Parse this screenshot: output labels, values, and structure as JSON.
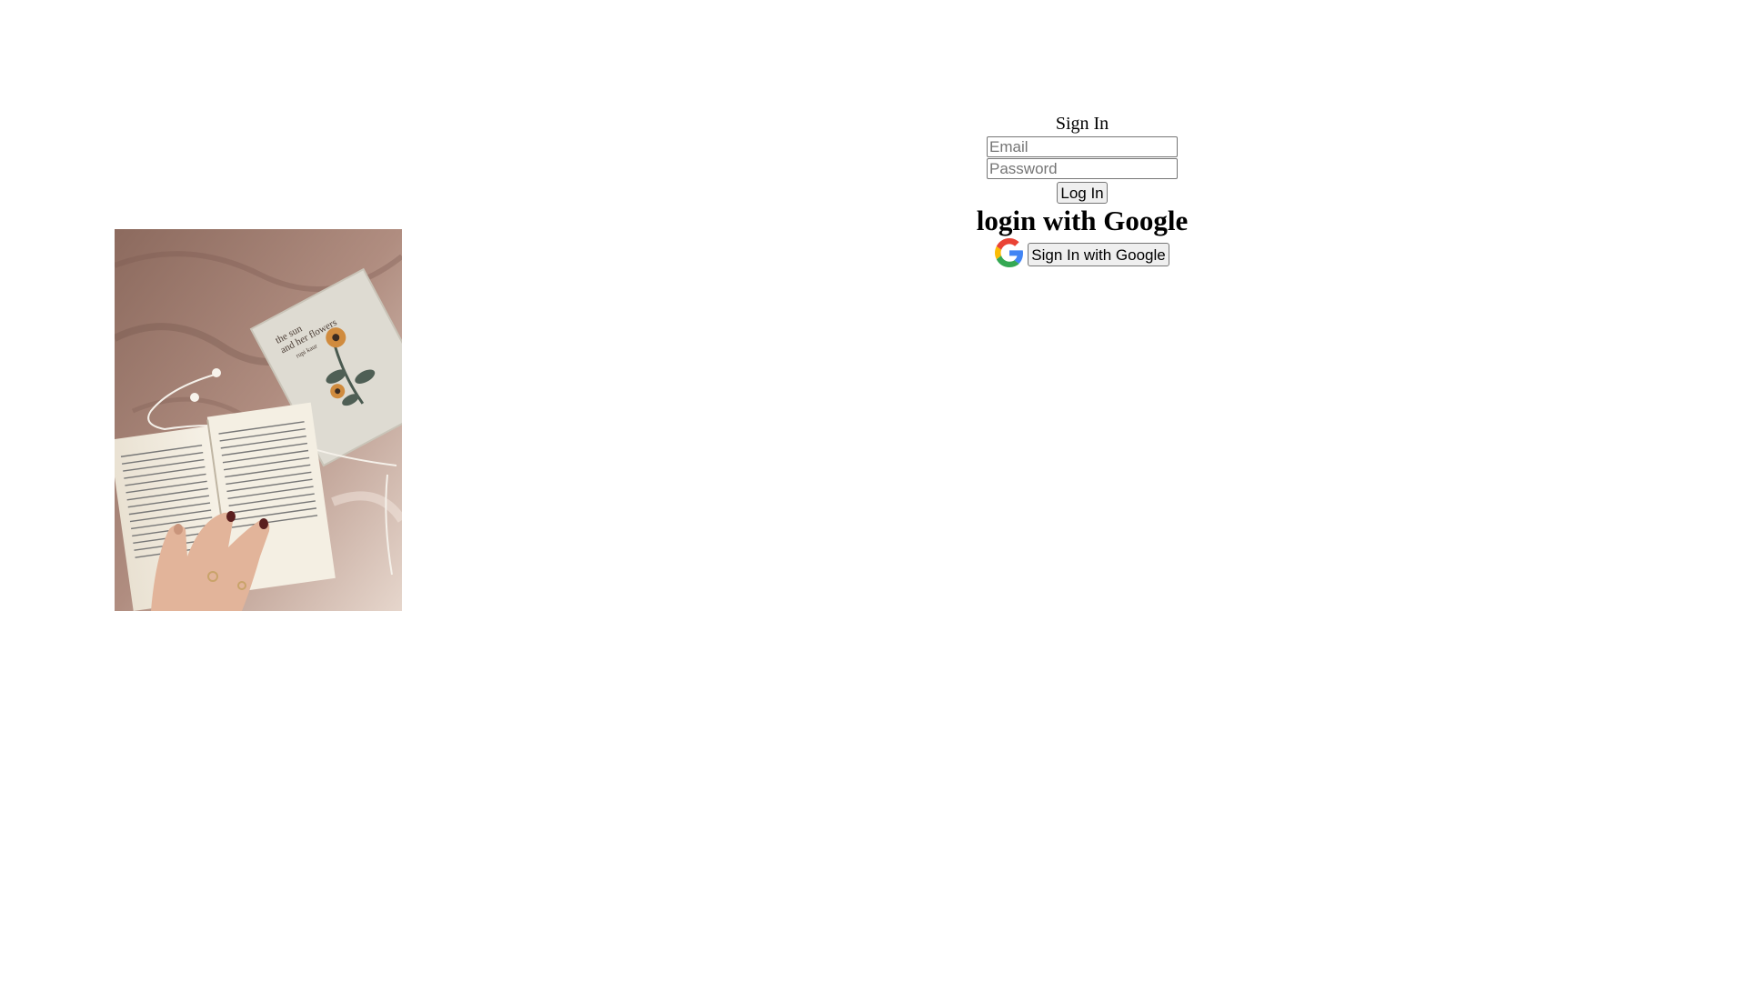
{
  "signin": {
    "title": "Sign In",
    "email_placeholder": "Email",
    "password_placeholder": "Password",
    "login_label": "Log In"
  },
  "google": {
    "heading": "login with Google",
    "button_label": "Sign In with Google",
    "icon": "google-g-icon"
  },
  "photo": {
    "icon": "reading-books-photo",
    "book_cover_text": [
      "the sun",
      "and her flowers",
      "rupi kaur"
    ]
  }
}
